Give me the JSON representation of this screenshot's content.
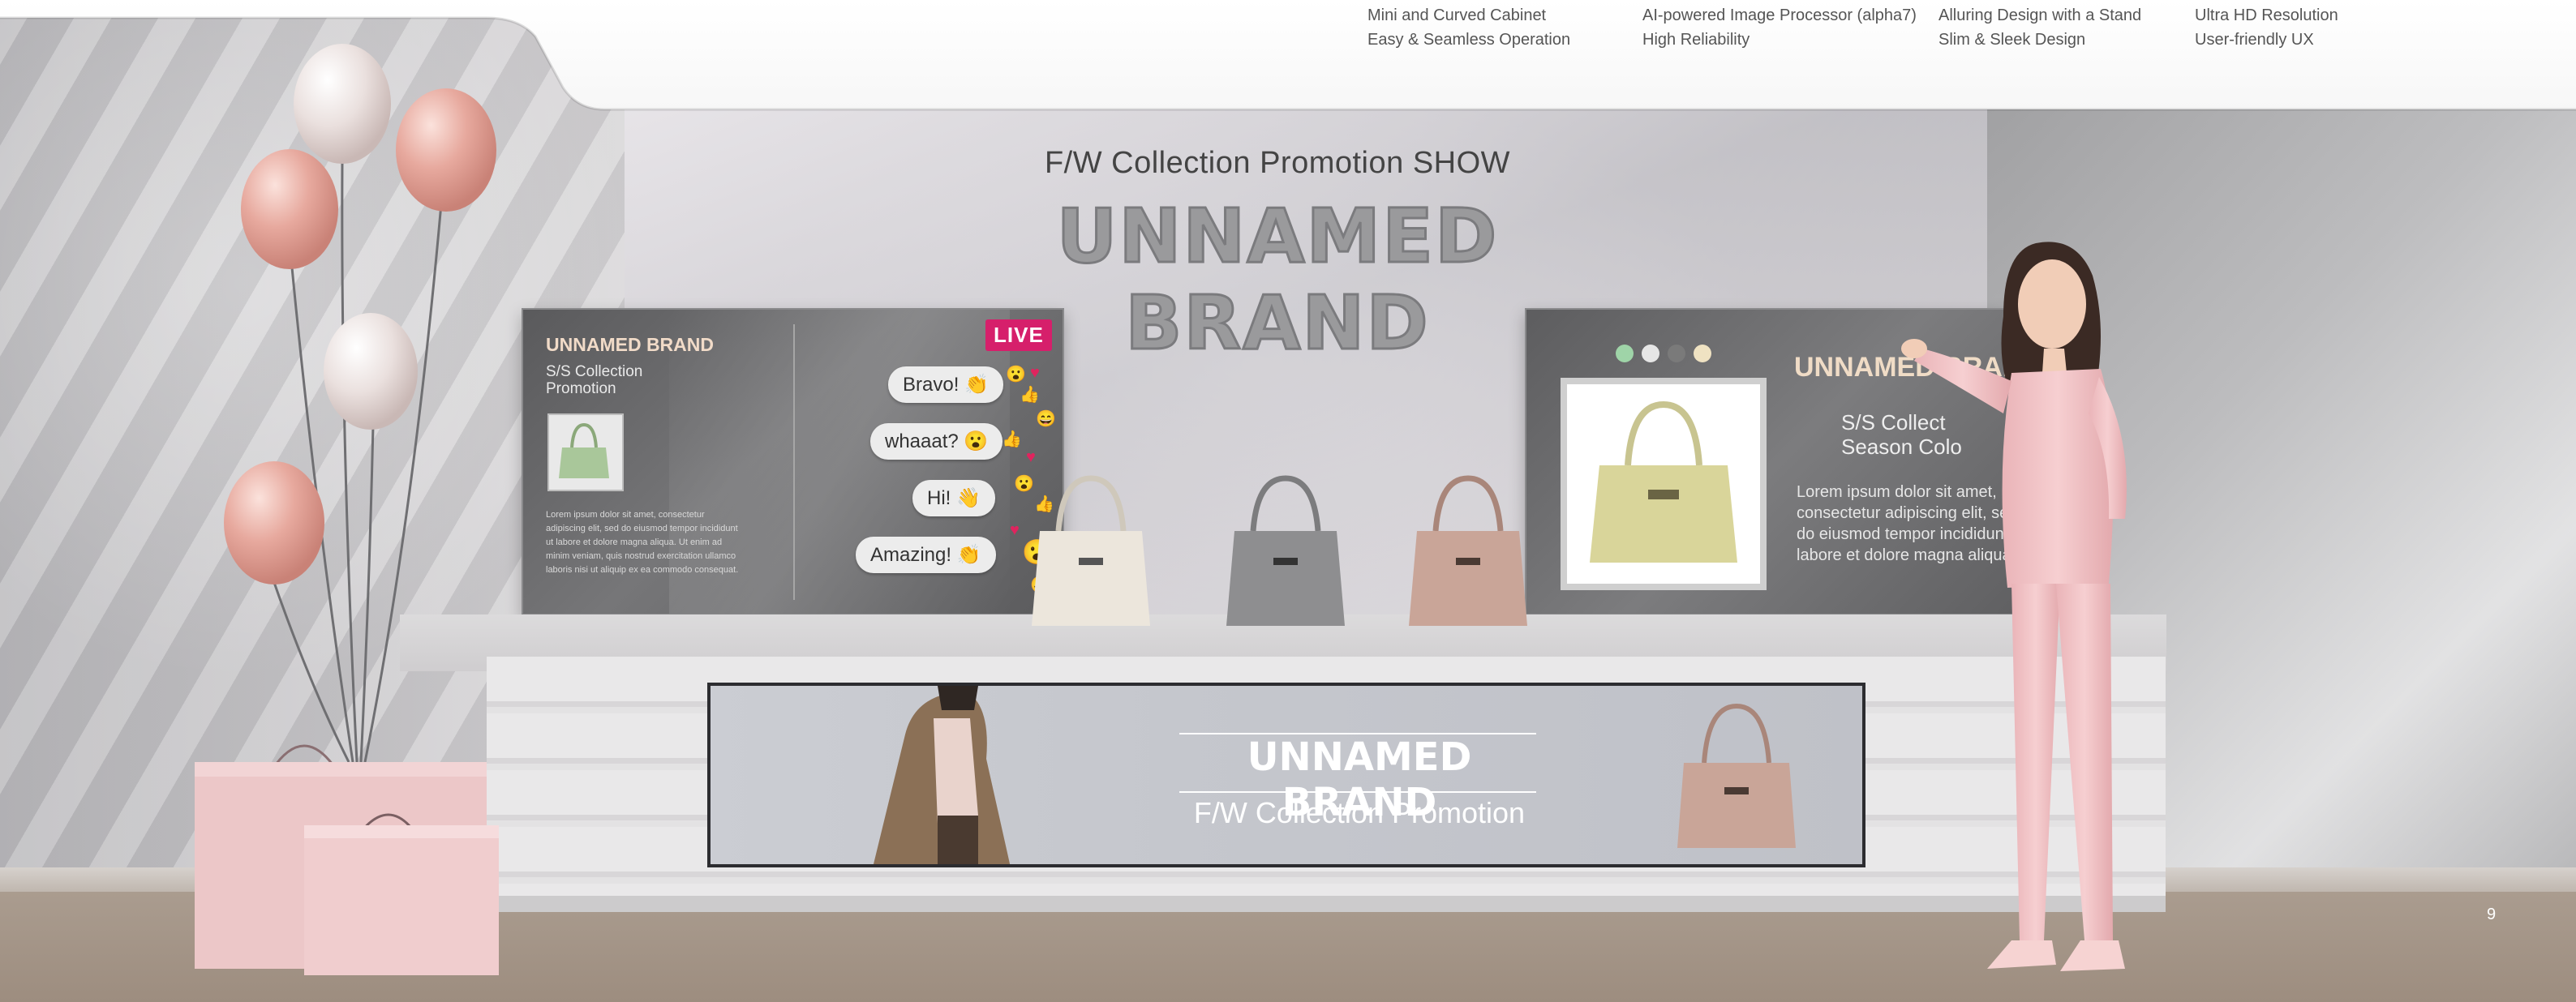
{
  "header": {
    "features": [
      [
        "Mini and Curved Cabinet",
        "Easy & Seamless Operation"
      ],
      [
        "AI-powered Image Processor (alpha7)",
        "High Reliability"
      ],
      [
        "Alluring Design with a Stand",
        "Slim & Sleek Design"
      ],
      [
        "Ultra HD Resolution",
        "User-friendly UX"
      ]
    ]
  },
  "show": {
    "subtitle": "F/W Collection Promotion SHOW",
    "brand": "UNNAMED BRAND"
  },
  "left_screen": {
    "brand": "UNNAMED BRAND",
    "subtitle": "S/S Collection Promotion",
    "body": "Lorem ipsum dolor sit amet, consectetur adipiscing elit, sed do eiusmod tempor incididunt ut labore et dolore magna aliqua. Ut enim ad minim veniam, quis nostrud exercitation ullamco laboris nisi ut aliquip ex ea commodo consequat.",
    "live_label": "LIVE",
    "comments": [
      "Bravo! 👏",
      "whaaat? 😮",
      "Hi! 👋",
      "Amazing! 👏"
    ]
  },
  "right_screen": {
    "brand": "UNNAMED BRAND",
    "subtitle_line1": "S/S Collect",
    "subtitle_line2": "Season Colo",
    "body": "Lorem ipsum dolor sit amet, consectetur adipiscing elit, sed do eiusmod tempor incididunt ut labore et dolore magna aliqua.",
    "dot_colors": [
      "#9fd4a8",
      "#e6e6e6",
      "#7a7a7a",
      "#efe2c2"
    ]
  },
  "stretch_display": {
    "brand": "UNNAMED BRAND",
    "subtitle": "F/W Collection Promotion"
  },
  "page_number": "9",
  "colors": {
    "blush": "#e8b4aa",
    "bag_pink": "#eec4c7",
    "live_red": "#d61f6b"
  }
}
